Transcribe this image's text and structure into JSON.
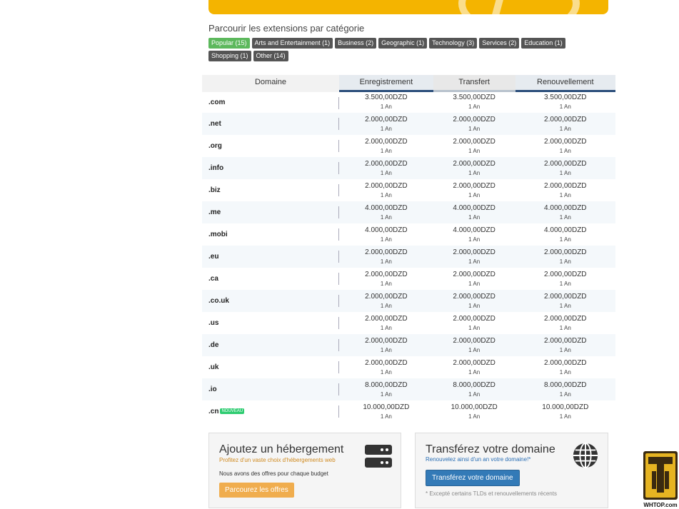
{
  "categories": {
    "title": "Parcourir les extensions par catégorie",
    "items": [
      {
        "label": "Popular (15)",
        "active": true
      },
      {
        "label": "Arts and Entertainment (1)",
        "active": false
      },
      {
        "label": "Business (2)",
        "active": false
      },
      {
        "label": "Geographic (1)",
        "active": false
      },
      {
        "label": "Technology (3)",
        "active": false
      },
      {
        "label": "Services (2)",
        "active": false
      },
      {
        "label": "Education (1)",
        "active": false
      },
      {
        "label": "Shopping (1)",
        "active": false
      },
      {
        "label": "Other (14)",
        "active": false
      }
    ]
  },
  "table": {
    "headers": {
      "domain": "Domaine",
      "register": "Enregistrement",
      "transfer": "Transfert",
      "renew": "Renouvellement"
    },
    "rows": [
      {
        "tld": ".com",
        "register": "3.500,00DZD",
        "transfer": "3.500,00DZD",
        "renew": "3.500,00DZD",
        "term": "1 An",
        "badge": ""
      },
      {
        "tld": ".net",
        "register": "2.000,00DZD",
        "transfer": "2.000,00DZD",
        "renew": "2.000,00DZD",
        "term": "1 An",
        "badge": ""
      },
      {
        "tld": ".org",
        "register": "2.000,00DZD",
        "transfer": "2.000,00DZD",
        "renew": "2.000,00DZD",
        "term": "1 An",
        "badge": ""
      },
      {
        "tld": ".info",
        "register": "2.000,00DZD",
        "transfer": "2.000,00DZD",
        "renew": "2.000,00DZD",
        "term": "1 An",
        "badge": ""
      },
      {
        "tld": ".biz",
        "register": "2.000,00DZD",
        "transfer": "2.000,00DZD",
        "renew": "2.000,00DZD",
        "term": "1 An",
        "badge": ""
      },
      {
        "tld": ".me",
        "register": "4.000,00DZD",
        "transfer": "4.000,00DZD",
        "renew": "4.000,00DZD",
        "term": "1 An",
        "badge": ""
      },
      {
        "tld": ".mobi",
        "register": "4.000,00DZD",
        "transfer": "4.000,00DZD",
        "renew": "4.000,00DZD",
        "term": "1 An",
        "badge": ""
      },
      {
        "tld": ".eu",
        "register": "2.000,00DZD",
        "transfer": "2.000,00DZD",
        "renew": "2.000,00DZD",
        "term": "1 An",
        "badge": ""
      },
      {
        "tld": ".ca",
        "register": "2.000,00DZD",
        "transfer": "2.000,00DZD",
        "renew": "2.000,00DZD",
        "term": "1 An",
        "badge": ""
      },
      {
        "tld": ".co.uk",
        "register": "2.000,00DZD",
        "transfer": "2.000,00DZD",
        "renew": "2.000,00DZD",
        "term": "1 An",
        "badge": ""
      },
      {
        "tld": ".us",
        "register": "2.000,00DZD",
        "transfer": "2.000,00DZD",
        "renew": "2.000,00DZD",
        "term": "1 An",
        "badge": ""
      },
      {
        "tld": ".de",
        "register": "2.000,00DZD",
        "transfer": "2.000,00DZD",
        "renew": "2.000,00DZD",
        "term": "1 An",
        "badge": ""
      },
      {
        "tld": ".uk",
        "register": "2.000,00DZD",
        "transfer": "2.000,00DZD",
        "renew": "2.000,00DZD",
        "term": "1 An",
        "badge": ""
      },
      {
        "tld": ".io",
        "register": "8.000,00DZD",
        "transfer": "8.000,00DZD",
        "renew": "8.000,00DZD",
        "term": "1 An",
        "badge": ""
      },
      {
        "tld": ".cn",
        "register": "10.000,00DZD",
        "transfer": "10.000,00DZD",
        "renew": "10.000,00DZD",
        "term": "1 An",
        "badge": "NOUVEAU"
      }
    ]
  },
  "hosting_box": {
    "title": "Ajoutez un hébergement",
    "subtitle": "Profitez d'un vaste choix d'hébergements web",
    "description": "Nous avons des offres pour chaque budget",
    "button": "Parcourez les offres",
    "icon": "server-icon"
  },
  "transfer_box": {
    "title": "Transférez votre domaine",
    "subtitle": "Renouvelez ainsi d'un an votre domaine!*",
    "button": "Transférez votre domaine",
    "note": "* Excepté certains TLDs et renouvellements récents",
    "icon": "globe-icon"
  },
  "watermark": {
    "logo_text": "WHTOP.com"
  },
  "colors": {
    "accent_green": "#5cb85c",
    "banner": "#f4b400",
    "primary_blue": "#337ab7",
    "orange": "#f0ad4e",
    "header_underline": "#2a4d7a"
  }
}
